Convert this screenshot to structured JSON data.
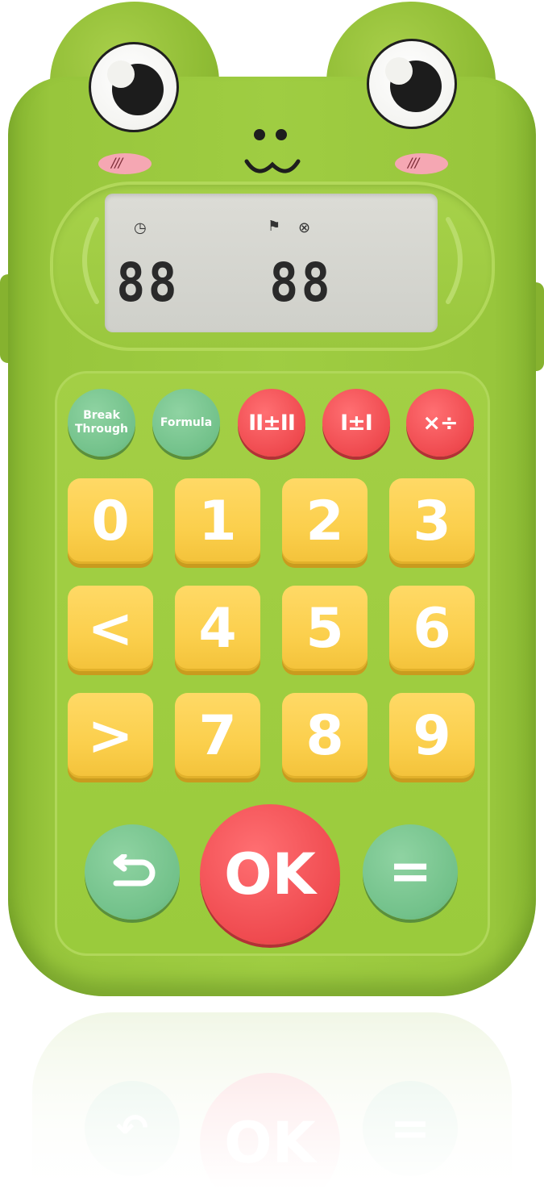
{
  "display": {
    "left_digits": "88",
    "right_digits": "88"
  },
  "top_buttons": [
    {
      "label": "Break Through",
      "color": "#72c18a"
    },
    {
      "label": "Formula",
      "color": "#72c18a"
    },
    {
      "label": "II±II",
      "color": "#ef4a4f"
    },
    {
      "label": "I±I",
      "color": "#ef4a4f"
    },
    {
      "label": "×÷",
      "color": "#ef4a4f"
    }
  ],
  "keys": {
    "row1": [
      "0",
      "1",
      "2",
      "3"
    ],
    "row2": [
      "<",
      "4",
      "5",
      "6"
    ],
    "row3": [
      ">",
      "7",
      "8",
      "9"
    ]
  },
  "bottom_buttons": {
    "back_icon": "return-arrow-icon",
    "ok": "OK",
    "equals": "="
  },
  "colors": {
    "body_green": "#9fcd42",
    "key_yellow": "#fbcf4c",
    "button_green": "#72c18a",
    "button_red": "#ef4a4f",
    "lcd": "#d6d6d0"
  }
}
